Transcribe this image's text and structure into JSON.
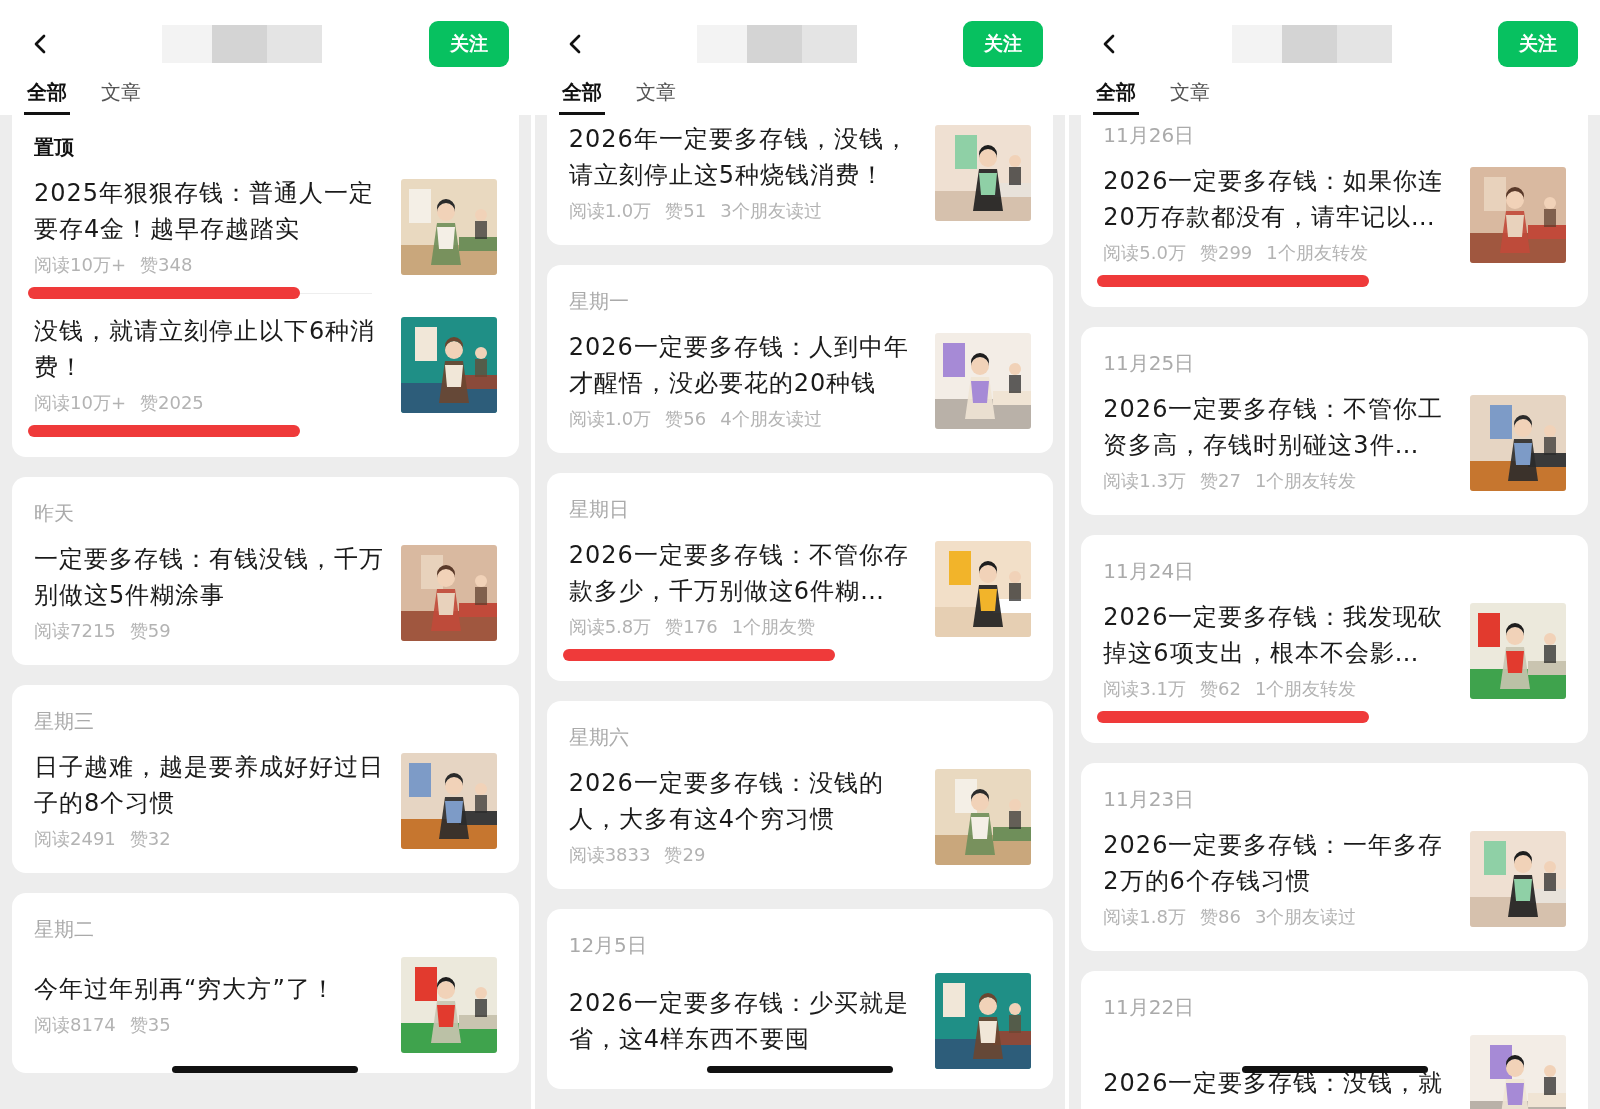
{
  "panels": [
    {
      "follow_button": "关注",
      "tabs": [
        {
          "label": "全部",
          "selected": true
        },
        {
          "label": "文章",
          "selected": false
        }
      ],
      "groups": [
        {
          "kind": "pinned",
          "label": "置顶",
          "articles": [
            {
              "title": "2025年狠狠存钱：普通人一定要存4金！越早存越踏实",
              "stats": [
                "阅读10万+",
                "赞348"
              ],
              "highlighted": true
            },
            {
              "title": "没钱，就请立刻停止以下6种消费！",
              "stats": [
                "阅读10万+",
                "赞2025"
              ],
              "highlighted": true
            }
          ]
        },
        {
          "kind": "date",
          "label": "昨天",
          "articles": [
            {
              "title": "一定要多存钱：有钱没钱，千万别做这5件糊涂事",
              "stats": [
                "阅读7215",
                "赞59"
              ],
              "highlighted": false
            }
          ]
        },
        {
          "kind": "date",
          "label": "星期三",
          "articles": [
            {
              "title": "日子越难，越是要养成好好过日子的8个习惯",
              "stats": [
                "阅读2491",
                "赞32"
              ],
              "highlighted": false
            }
          ]
        },
        {
          "kind": "date",
          "label": "星期二",
          "articles": [
            {
              "title": "今年过年别再“穷大方”了！",
              "stats": [
                "阅读8174",
                "赞35"
              ],
              "highlighted": false
            }
          ]
        }
      ]
    },
    {
      "follow_button": "关注",
      "tabs": [
        {
          "label": "全部",
          "selected": true
        },
        {
          "label": "文章",
          "selected": false
        }
      ],
      "groups": [
        {
          "kind": "date",
          "articles": [
            {
              "title": "2026年一定要多存钱，没钱，请立刻停止这5种烧钱消费！",
              "stats": [
                "阅读1.0万",
                "赞51",
                "3个朋友读过"
              ],
              "highlighted": false
            }
          ]
        },
        {
          "kind": "date",
          "label": "星期一",
          "articles": [
            {
              "title": "2026一定要多存钱：人到中年才醒悟，没必要花的20种钱",
              "stats": [
                "阅读1.0万",
                "赞56",
                "4个朋友读过"
              ],
              "highlighted": false
            }
          ]
        },
        {
          "kind": "date",
          "label": "星期日",
          "articles": [
            {
              "title": "2026一定要多存钱：不管你存款多少，千万别做这6件糊…",
              "stats": [
                "阅读5.8万",
                "赞176",
                "1个朋友赞"
              ],
              "highlighted": true
            }
          ]
        },
        {
          "kind": "date",
          "label": "星期六",
          "articles": [
            {
              "title": "2026一定要多存钱：没钱的人，大多有这4个穷习惯",
              "stats": [
                "阅读3833",
                "赞29"
              ],
              "highlighted": false
            }
          ]
        },
        {
          "kind": "date",
          "label": "12月5日",
          "articles": [
            {
              "title": "2026一定要多存钱：少买就是省，这4样东西不要囤",
              "highlighted": false
            }
          ]
        }
      ]
    },
    {
      "follow_button": "关注",
      "tabs": [
        {
          "label": "全部",
          "selected": true
        },
        {
          "label": "文章",
          "selected": false
        }
      ],
      "groups": [
        {
          "kind": "date",
          "label": "11月26日",
          "articles": [
            {
              "title": "2026一定要多存钱：如果你连20万存款都没有，请牢记以…",
              "stats": [
                "阅读5.0万",
                "赞299",
                "1个朋友转发"
              ],
              "highlighted": true
            }
          ]
        },
        {
          "kind": "date",
          "label": "11月25日",
          "articles": [
            {
              "title": "2026一定要多存钱：不管你工资多高，存钱时别碰这3件…",
              "stats": [
                "阅读1.3万",
                "赞27",
                "1个朋友转发"
              ],
              "highlighted": false
            }
          ]
        },
        {
          "kind": "date",
          "label": "11月24日",
          "articles": [
            {
              "title": "2026一定要多存钱：我发现砍掉这6项支出，根本不会影…",
              "stats": [
                "阅读3.1万",
                "赞62",
                "1个朋友转发"
              ],
              "highlighted": true
            }
          ]
        },
        {
          "kind": "date",
          "label": "11月23日",
          "articles": [
            {
              "title": "2026一定要多存钱：一年多存2万的6个存钱习惯",
              "stats": [
                "阅读1.8万",
                "赞86",
                "3个朋友读过"
              ],
              "highlighted": false
            }
          ]
        },
        {
          "kind": "date",
          "label": "11月22日",
          "articles": [
            {
              "title": "2026一定要多存钱：没钱，就",
              "highlighted": false
            }
          ]
        }
      ]
    }
  ]
}
